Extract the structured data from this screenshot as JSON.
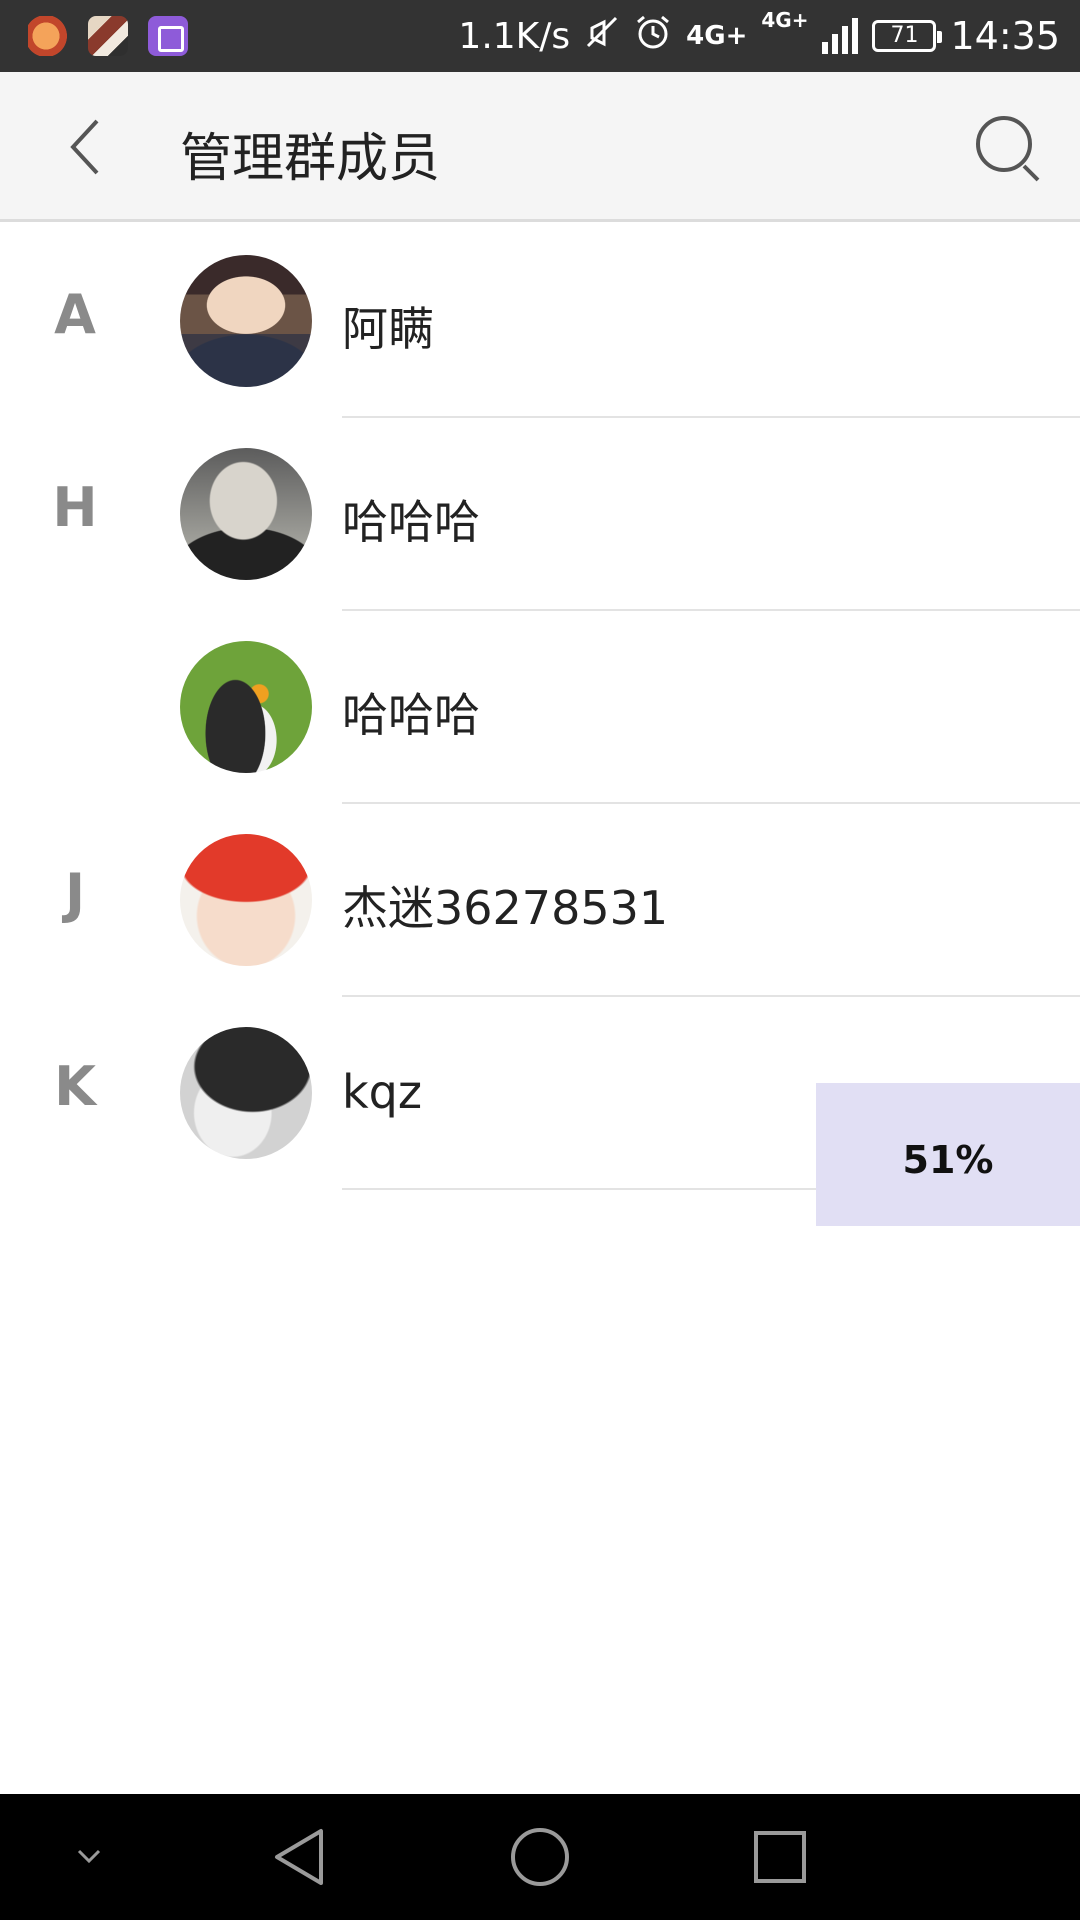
{
  "status_bar": {
    "net_speed": "1.1K/s",
    "network_type": "4G+",
    "network_type_2": "4G+",
    "battery": "71",
    "time": "14:35",
    "icons": [
      "mute-icon",
      "alarm-icon",
      "signal-icon",
      "battery-icon"
    ]
  },
  "header": {
    "title": "管理群成员",
    "back_icon": "chevron-left-icon",
    "search_icon": "search-icon"
  },
  "members": [
    {
      "index": "A",
      "name": "阿瞒"
    },
    {
      "index": "H",
      "name": "哈哈哈"
    },
    {
      "index": "",
      "name": "哈哈哈"
    },
    {
      "index": "J",
      "name": "杰迷36278531"
    },
    {
      "index": "K",
      "name": "kqz"
    }
  ],
  "overlay": {
    "progress_label": "51%",
    "progress_value": 0.51
  },
  "nav_bar": {
    "icons": [
      "collapse-icon",
      "back-icon",
      "home-icon",
      "recents-icon"
    ]
  },
  "colors": {
    "status_bar": "#333333",
    "app_bar": "#f5f5f5",
    "index_letter": "#8a8a8a",
    "overlay": "#e1dff4",
    "nav_bar": "#000000"
  }
}
